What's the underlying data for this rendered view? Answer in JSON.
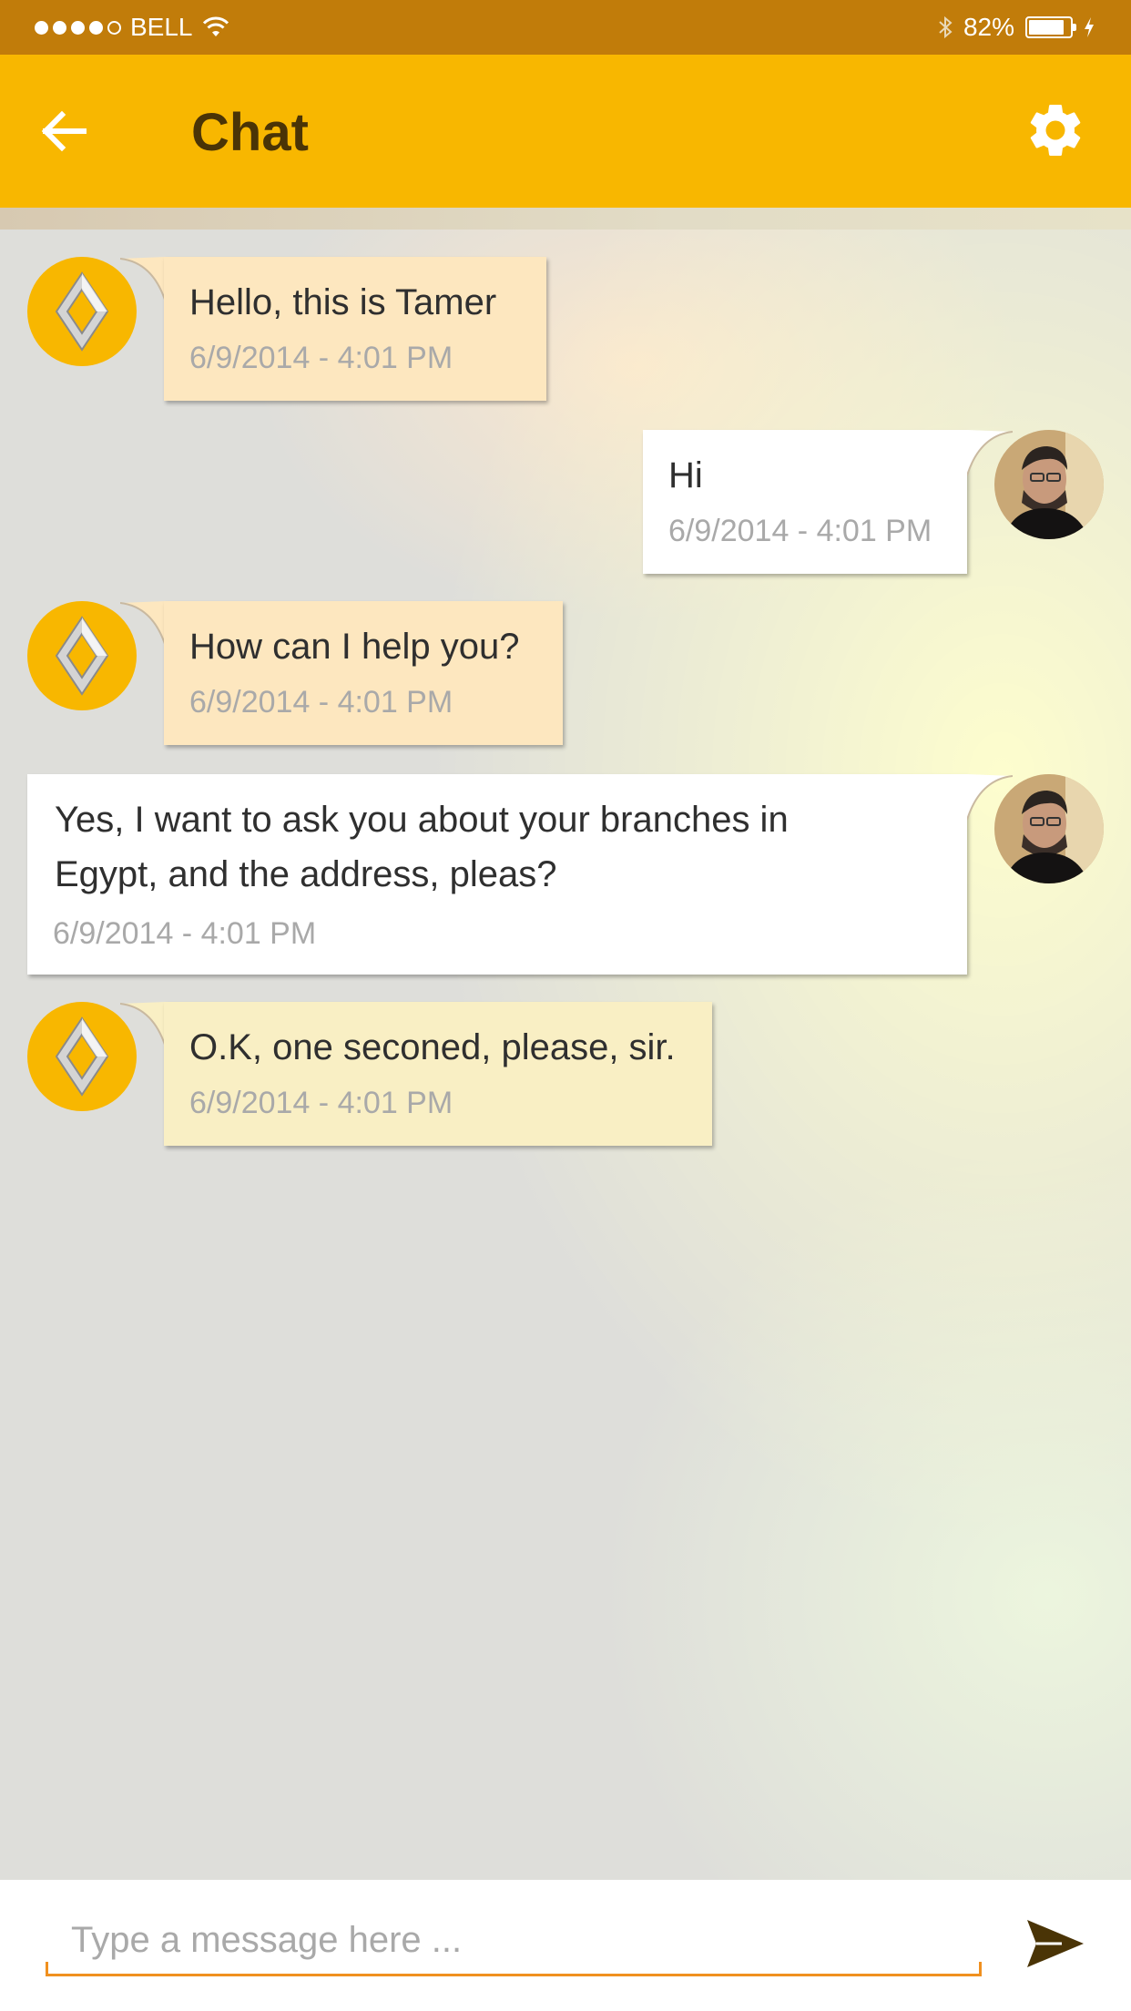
{
  "status_bar": {
    "carrier": "BELL",
    "battery": "82%"
  },
  "app_bar": {
    "title": "Chat"
  },
  "messages": [
    {
      "sender": "agent",
      "text": "Hello, this is Tamer",
      "time": "6/9/2014 - 4:01 PM"
    },
    {
      "sender": "user",
      "text": "Hi",
      "time": "6/9/2014 - 4:01 PM"
    },
    {
      "sender": "agent",
      "text": "How can I help you?",
      "time": "6/9/2014 - 4:01 PM"
    },
    {
      "sender": "user",
      "text_line1": "Yes, I want to ask you about your branches in",
      "text_line2": "Egypt, and the address, pleas?",
      "time": "6/9/2014 - 4:01 PM"
    },
    {
      "sender": "agent",
      "text": "O.K, one seconed, please, sir.",
      "time": "6/9/2014 - 4:01 PM"
    }
  ],
  "composer": {
    "placeholder": "Type a message here ..."
  },
  "colors": {
    "status_bar": "#c17c0a",
    "app_bar": "#f8b700",
    "title": "#4a3406",
    "incoming_bubble": "#fde7bf",
    "outgoing_bubble": "#ffffff",
    "input_underline": "#f0901f",
    "send_icon": "#4a3406"
  }
}
